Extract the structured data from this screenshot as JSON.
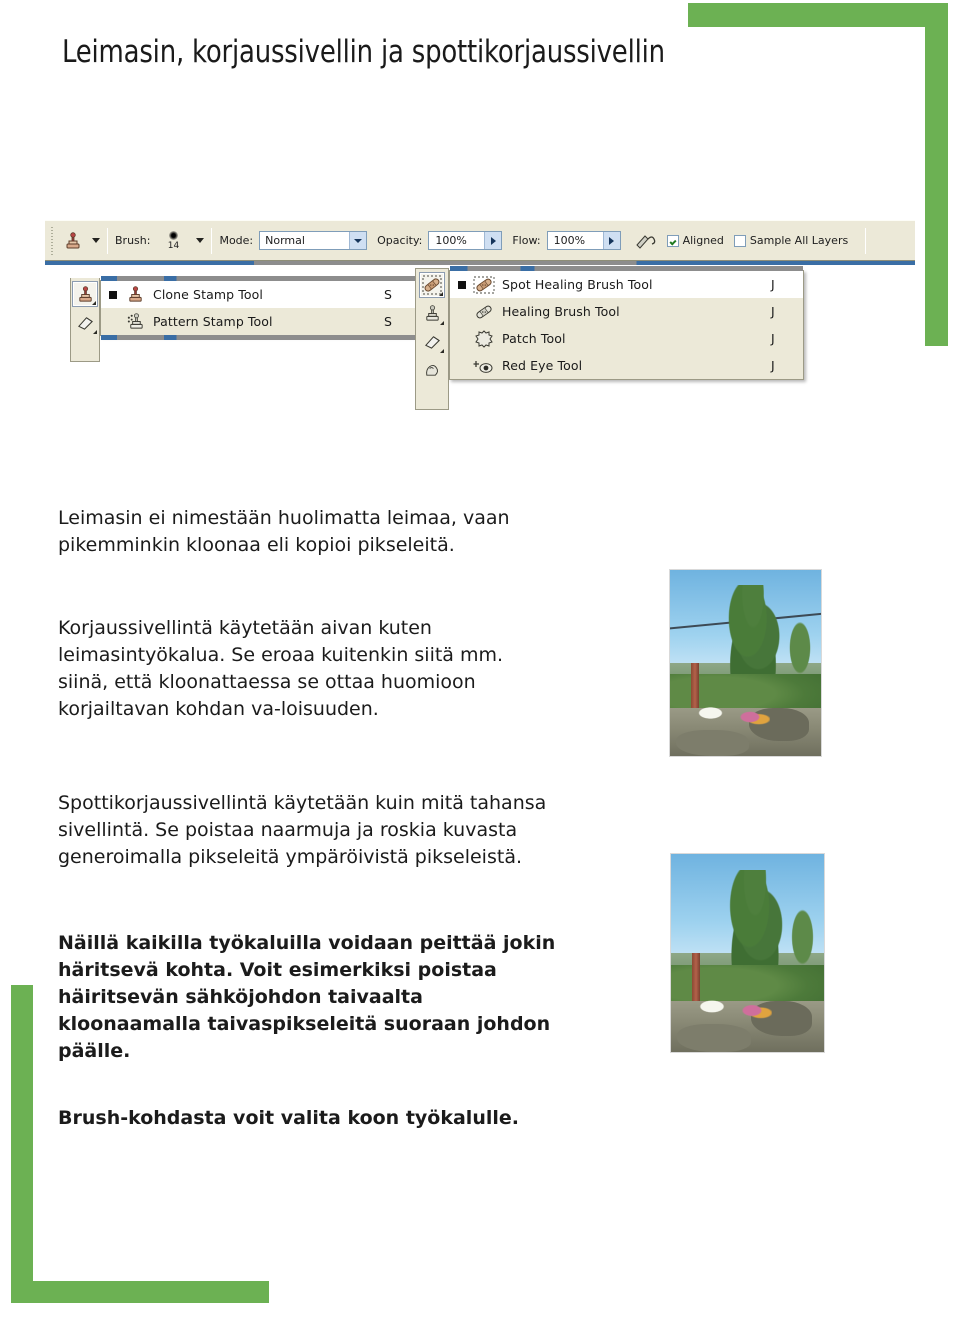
{
  "slide": {
    "title": "Leimasin, korjaussivellin ja spottikorjaussivellin",
    "accent_color": "#6cb153",
    "background_color": "#ffffff",
    "text_color": "#1b1b1b"
  },
  "photoshop": {
    "options_bar": {
      "tool_preset_icon": "clone-stamp-icon",
      "brush_label": "Brush:",
      "brush_size": "14",
      "mode_label": "Mode:",
      "mode_value": "Normal",
      "opacity_label": "Opacity:",
      "opacity_value": "100%",
      "flow_label": "Flow:",
      "flow_value": "100%",
      "airbrush_icon": "airbrush-icon",
      "aligned_label": "Aligned",
      "aligned_checked": true,
      "sample_all_layers_label": "Sample All Layers",
      "sample_all_layers_checked": false
    },
    "stamp_flyout": {
      "items": [
        {
          "label": "Clone Stamp Tool",
          "shortcut": "S",
          "icon": "clone-stamp-icon",
          "active": true
        },
        {
          "label": "Pattern Stamp Tool",
          "shortcut": "S",
          "icon": "pattern-stamp-icon",
          "active": false
        }
      ]
    },
    "stamp_toolbar": {
      "buttons": [
        {
          "icon": "clone-stamp-icon",
          "selected": true
        },
        {
          "icon": "eraser-icon",
          "selected": false
        }
      ]
    },
    "healing_flyout": {
      "items": [
        {
          "label": "Spot Healing Brush Tool",
          "shortcut": "J",
          "icon": "spot-healing-brush-icon",
          "active": true
        },
        {
          "label": "Healing Brush Tool",
          "shortcut": "J",
          "icon": "healing-brush-icon",
          "active": false
        },
        {
          "label": "Patch Tool",
          "shortcut": "J",
          "icon": "patch-icon",
          "active": false
        },
        {
          "label": "Red Eye Tool",
          "shortcut": "J",
          "icon": "red-eye-icon",
          "active": false
        }
      ]
    },
    "healing_toolbar": {
      "buttons": [
        {
          "icon": "spot-healing-brush-icon",
          "selected": true
        },
        {
          "icon": "clone-stamp-icon",
          "selected": false
        },
        {
          "icon": "eraser-icon",
          "selected": false
        },
        {
          "icon": "smudge-icon",
          "selected": false
        }
      ]
    }
  },
  "body": {
    "paragraph_1": "Leimasin ei nimestään huolimatta leimaa, vaan pikemminkin kloonaa eli kopioi pikseleitä.",
    "paragraph_2": "Korjaussivellintä käytetään aivan kuten leimasintyökalua. Se eroaa kuitenkin siitä mm. siinä, että kloonattaessa se ottaa huomioon korjailtavan kohdan va-loisuuden.",
    "paragraph_3": "Spottikorjaussivellintä käytetään kuin mitä tahansa sivellintä. Se poistaa naarmuja ja roskia kuvasta generoimalla pikseleitä ympäröivistä pikseleistä.",
    "paragraph_4": "Näillä kaikilla työkaluilla voidaan peittää jokin häritsevä kohta. Voit esimerkiksi poistaa häiritsevän sähköjohdon taivaalta kloonaamalla taivaspikseleitä suoraan johdon päälle.",
    "paragraph_5": "Brush-kohdasta voit valita koon työkalulle."
  },
  "photos": {
    "before": {
      "name": "landscape-with-power-line",
      "has_wire": true
    },
    "after": {
      "name": "landscape-power-line-removed",
      "has_wire": false
    }
  }
}
